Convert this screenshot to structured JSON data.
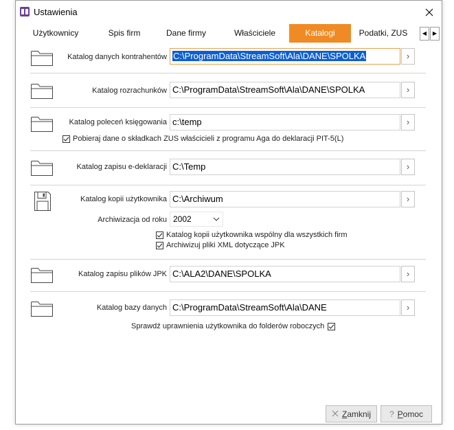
{
  "window": {
    "title": "Ustawienia"
  },
  "tabs": [
    {
      "label": "Użytkownicy"
    },
    {
      "label": "Spis firm"
    },
    {
      "label": "Dane firmy"
    },
    {
      "label": "Właściciele"
    },
    {
      "label": "Katalogi"
    },
    {
      "label": "Podatki, ZUS"
    }
  ],
  "active_tab": "Katalogi",
  "sections": {
    "kontrahenci": {
      "label": "Katalog danych kontrahentów",
      "value": "C:\\ProgramData\\StreamSoft\\Ala\\DANE\\SPOLKA"
    },
    "rozrachunki": {
      "label": "Katalog rozrachunków",
      "value": "C:\\ProgramData\\StreamSoft\\Ala\\DANE\\SPOLKA"
    },
    "polecenia": {
      "label": "Katalog poleceń księgowania",
      "value": "c:\\temp",
      "checkbox": {
        "label": "Pobieraj dane o składkach ZUS właścicieli z programu Aga do deklaracji PIT-5(L)",
        "checked": true
      }
    },
    "edeklaracje": {
      "label": "Katalog zapisu e-deklaracji",
      "value": "C:\\Temp"
    },
    "kopie": {
      "label": "Katalog kopii użytkownika",
      "value": "C:\\Archiwum",
      "archive_year_label": "Archiwizacja od roku",
      "archive_year": "2002",
      "checkbox_shared": {
        "label": "Katalog kopii użytkownika wspólny dla wszystkich firm",
        "checked": true
      },
      "checkbox_xml": {
        "label": "Archiwizuj pliki XML dotyczące JPK",
        "checked": true
      }
    },
    "jpk": {
      "label": "Katalog zapisu plików JPK",
      "value": "C:\\ALA2\\DANE\\SPOLKA"
    },
    "baza": {
      "label": "Katalog bazy danych",
      "value": "C:\\ProgramData\\StreamSoft\\Ala\\DANE",
      "checkbox": {
        "label": "Sprawdź uprawnienia użytkownika do folderów roboczych",
        "checked": true
      }
    }
  },
  "buttons": {
    "close": {
      "accel": "Z",
      "rest": "amknij"
    },
    "help": {
      "accel": "P",
      "rest": "omoc"
    }
  },
  "colors": {
    "accent": "#f08a24",
    "selection": "#0d5fd1"
  }
}
